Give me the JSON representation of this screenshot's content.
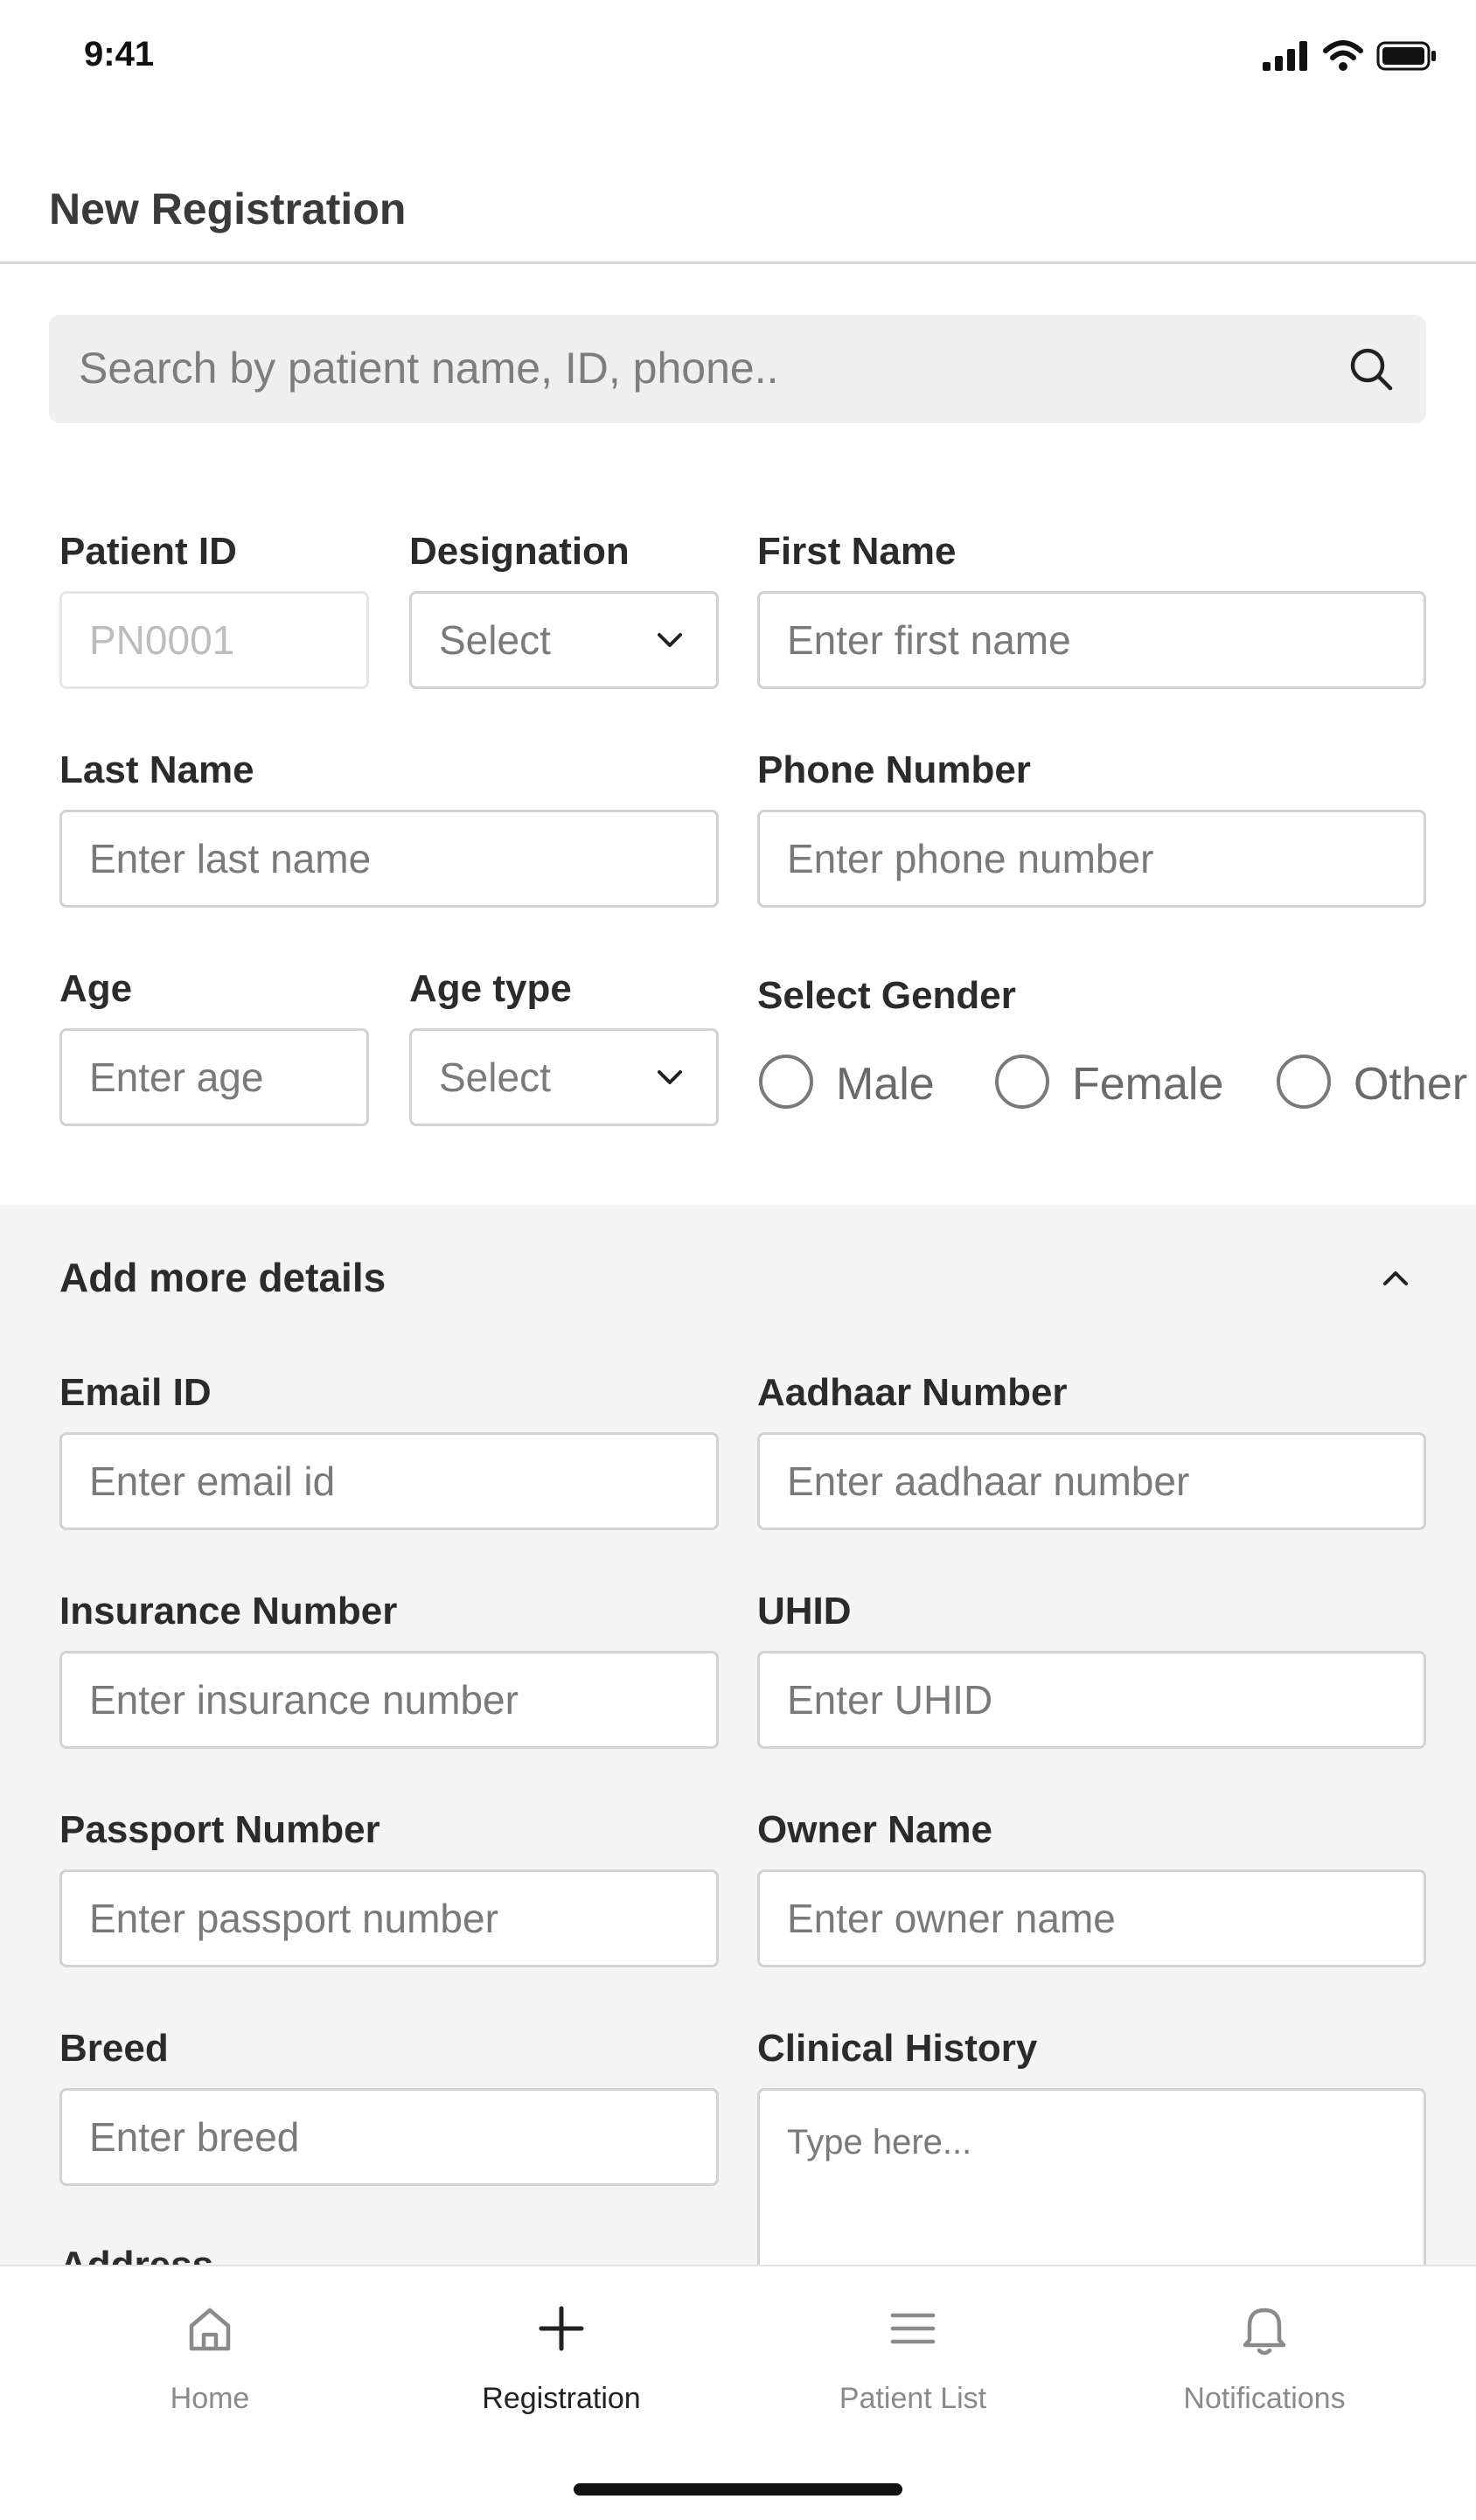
{
  "status_bar": {
    "time": "9:41",
    "icons": [
      "signal-icon",
      "wifi-icon",
      "battery-icon"
    ]
  },
  "header": {
    "title": "New Registration"
  },
  "search": {
    "placeholder": "Search by patient name, ID, phone..",
    "icon": "search-icon"
  },
  "form": {
    "patient_id": {
      "label": "Patient ID",
      "value": "PN0001"
    },
    "designation": {
      "label": "Designation",
      "value": "Select"
    },
    "first_name": {
      "label": "First Name",
      "placeholder": "Enter first name"
    },
    "last_name": {
      "label": "Last Name",
      "placeholder": "Enter last name"
    },
    "phone_number": {
      "label": "Phone Number",
      "placeholder": "Enter phone number"
    },
    "age": {
      "label": "Age",
      "placeholder": "Enter age"
    },
    "age_type": {
      "label": "Age type",
      "value": "Select"
    },
    "gender": {
      "label": "Select Gender",
      "options": [
        "Male",
        "Female",
        "Other"
      ],
      "selected": null
    }
  },
  "more_details": {
    "title": "Add more details",
    "expanded": true,
    "email": {
      "label": "Email ID",
      "placeholder": "Enter email id"
    },
    "aadhaar": {
      "label": "Aadhaar Number",
      "placeholder": "Enter aadhaar number"
    },
    "insurance": {
      "label": "Insurance Number",
      "placeholder": "Enter insurance number"
    },
    "uhid": {
      "label": "UHID",
      "placeholder": "Enter UHID"
    },
    "passport": {
      "label": "Passport Number",
      "placeholder": "Enter passport number"
    },
    "owner_name": {
      "label": "Owner Name",
      "placeholder": "Enter owner name"
    },
    "breed": {
      "label": "Breed",
      "placeholder": "Enter breed"
    },
    "clinical_history": {
      "label": "Clinical History",
      "placeholder": "Type here..."
    },
    "address": {
      "label": "Address"
    }
  },
  "bottom_nav": {
    "items": [
      {
        "label": "Home",
        "icon": "home-icon",
        "active": false
      },
      {
        "label": "Registration",
        "icon": "plus-icon",
        "active": true
      },
      {
        "label": "Patient List",
        "icon": "list-icon",
        "active": false
      },
      {
        "label": "Notifications",
        "icon": "bell-icon",
        "active": false
      }
    ]
  },
  "colors": {
    "background": "#ffffff",
    "section_background": "#f4f4f4",
    "search_background": "#efefef",
    "border": "#d2d2d2",
    "text_primary": "#2b2b2b",
    "text_placeholder": "#7a7a7a",
    "nav_inactive": "#8a8a8a",
    "nav_active": "#222222"
  }
}
